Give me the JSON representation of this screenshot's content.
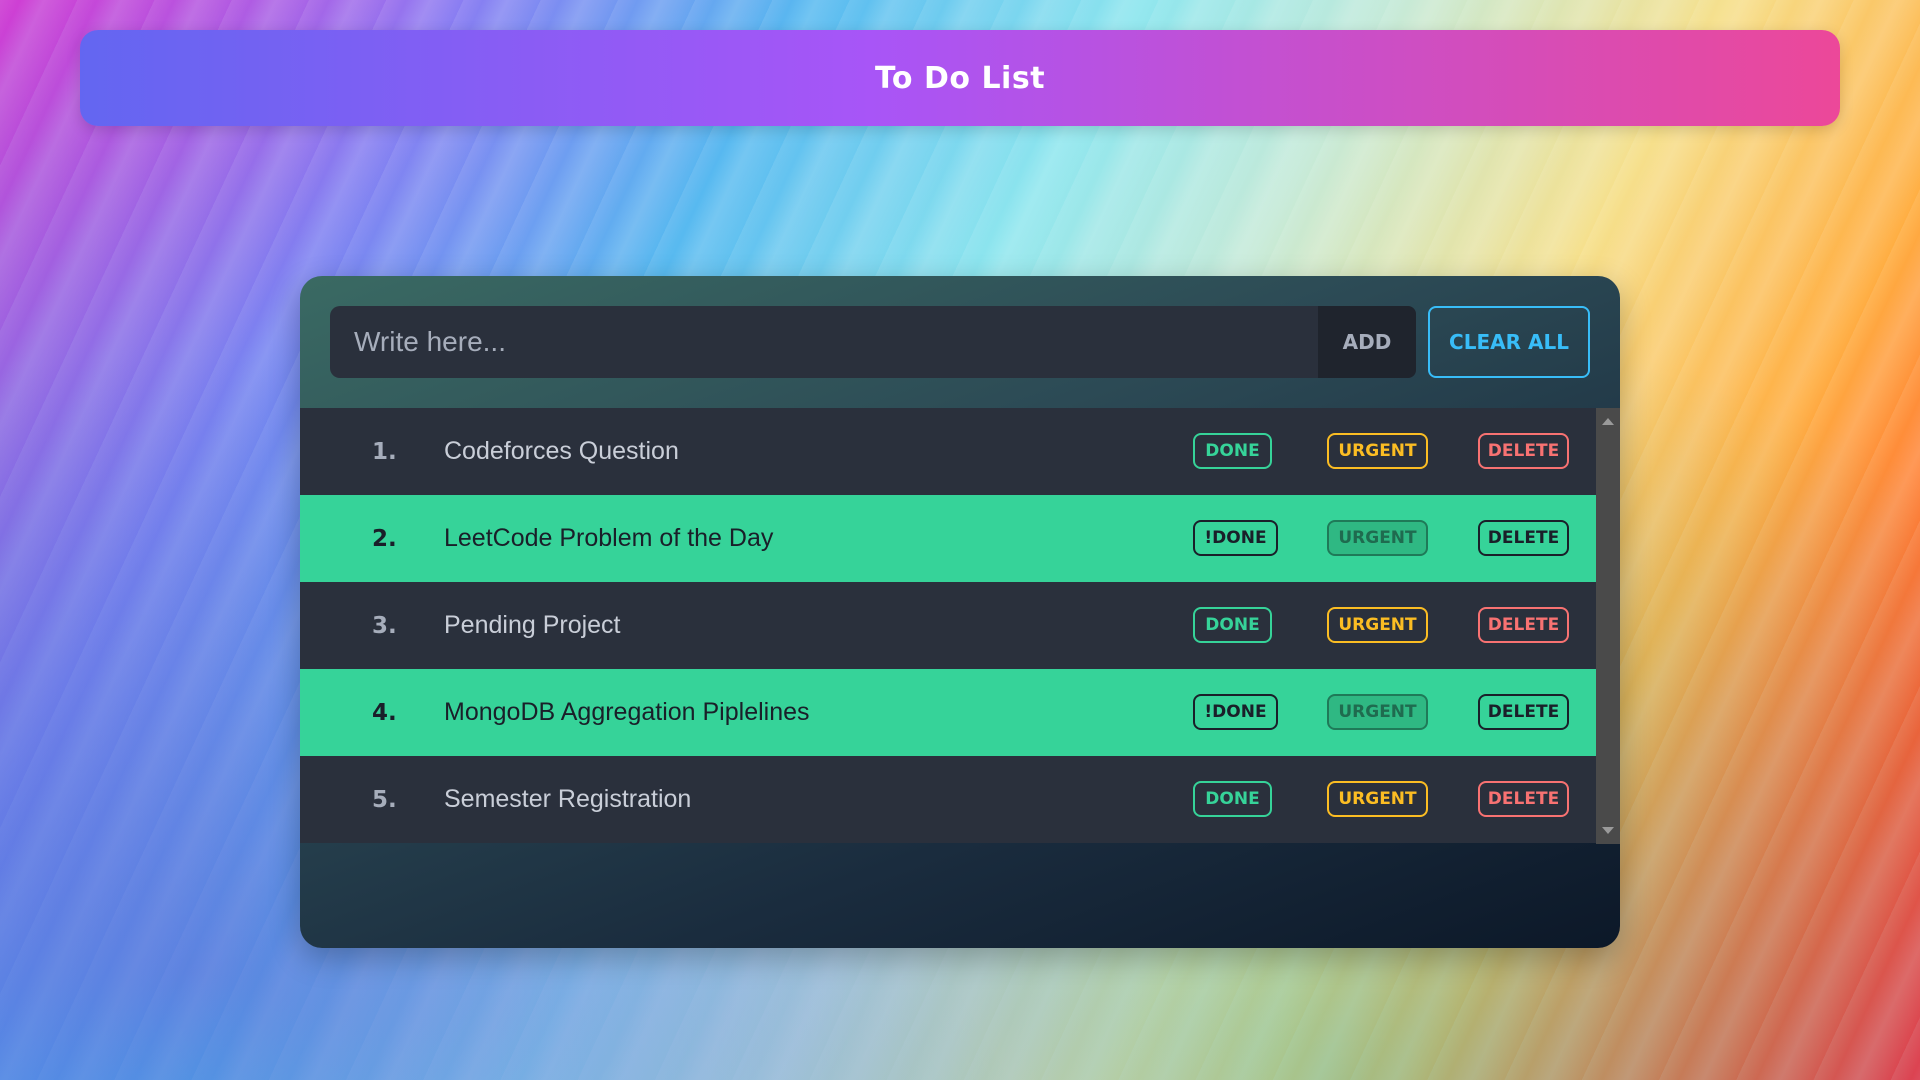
{
  "header": {
    "title": "To Do List"
  },
  "input": {
    "placeholder": "Write here...",
    "value": ""
  },
  "buttons": {
    "add": "ADD",
    "clear_all": "CLEAR ALL"
  },
  "todos": [
    {
      "number": "1.",
      "text": "Codeforces Question",
      "done": false,
      "done_label": "DONE",
      "urgent_label": "URGENT",
      "delete_label": "DELETE"
    },
    {
      "number": "2.",
      "text": "LeetCode Problem of the Day",
      "done": true,
      "done_label": "!DONE",
      "urgent_label": "URGENT",
      "delete_label": "DELETE"
    },
    {
      "number": "3.",
      "text": "Pending Project",
      "done": false,
      "done_label": "DONE",
      "urgent_label": "URGENT",
      "delete_label": "DELETE"
    },
    {
      "number": "4.",
      "text": "MongoDB Aggregation Piplelines",
      "done": true,
      "done_label": "!DONE",
      "urgent_label": "URGENT",
      "delete_label": "DELETE"
    },
    {
      "number": "5.",
      "text": "Semester Registration",
      "done": false,
      "done_label": "DONE",
      "urgent_label": "URGENT",
      "delete_label": "DELETE"
    }
  ],
  "colors": {
    "header_gradient": [
      "#6366f1",
      "#a855f7",
      "#ec4899"
    ],
    "row_dark": "#2a303c",
    "row_done": "#36d399",
    "done_accent": "#36d399",
    "urgent_accent": "#fbbd23",
    "delete_accent": "#f87272",
    "clear_accent": "#38bdf8"
  },
  "icons": {
    "scroll_up": "triangle-up",
    "scroll_down": "triangle-down"
  }
}
